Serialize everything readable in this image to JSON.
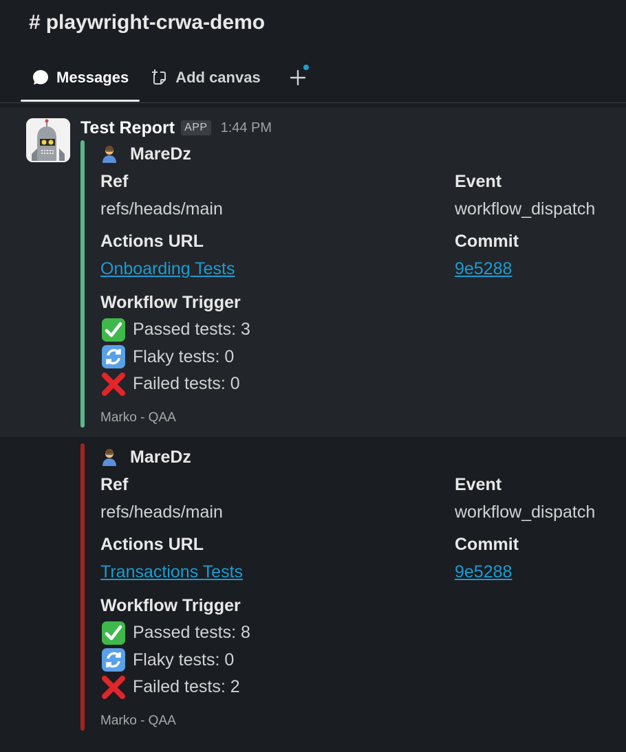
{
  "channel": {
    "hash": "#",
    "name": "playwright-crwa-demo"
  },
  "tabs": [
    {
      "label": "Messages",
      "icon": "chat-bubble-icon",
      "active": true
    },
    {
      "label": "Add canvas",
      "icon": "canvas-icon",
      "active": false
    }
  ],
  "message": {
    "sender": "Test Report",
    "badge": "APP",
    "time": "1:44 PM",
    "attachments": [
      {
        "bar_color": "#5bb88a",
        "author": "MareDz",
        "ref_label": "Ref",
        "ref_value": "refs/heads/main",
        "event_label": "Event",
        "event_value": "workflow_dispatch",
        "actions_label": "Actions URL",
        "actions_link": "Onboarding Tests",
        "commit_label": "Commit",
        "commit_link": "9e5288",
        "trigger_label": "Workflow Trigger",
        "passed": "Passed tests: 3",
        "flaky": "Flaky tests: 0",
        "failed": "Failed tests: 0",
        "footer": "Marko - QAA"
      },
      {
        "bar_color": "#a3231f",
        "author": "MareDz",
        "ref_label": "Ref",
        "ref_value": "refs/heads/main",
        "event_label": "Event",
        "event_value": "workflow_dispatch",
        "actions_label": "Actions URL",
        "actions_link": "Transactions Tests",
        "commit_label": "Commit",
        "commit_link": "9e5288",
        "trigger_label": "Workflow Trigger",
        "passed": "Passed tests: 8",
        "flaky": "Flaky tests: 0",
        "failed": "Failed tests: 2",
        "footer": "Marko - QAA"
      }
    ]
  },
  "colors": {
    "link": "#1d9bd1",
    "background": "#1a1d21",
    "highlight": "#222529"
  }
}
